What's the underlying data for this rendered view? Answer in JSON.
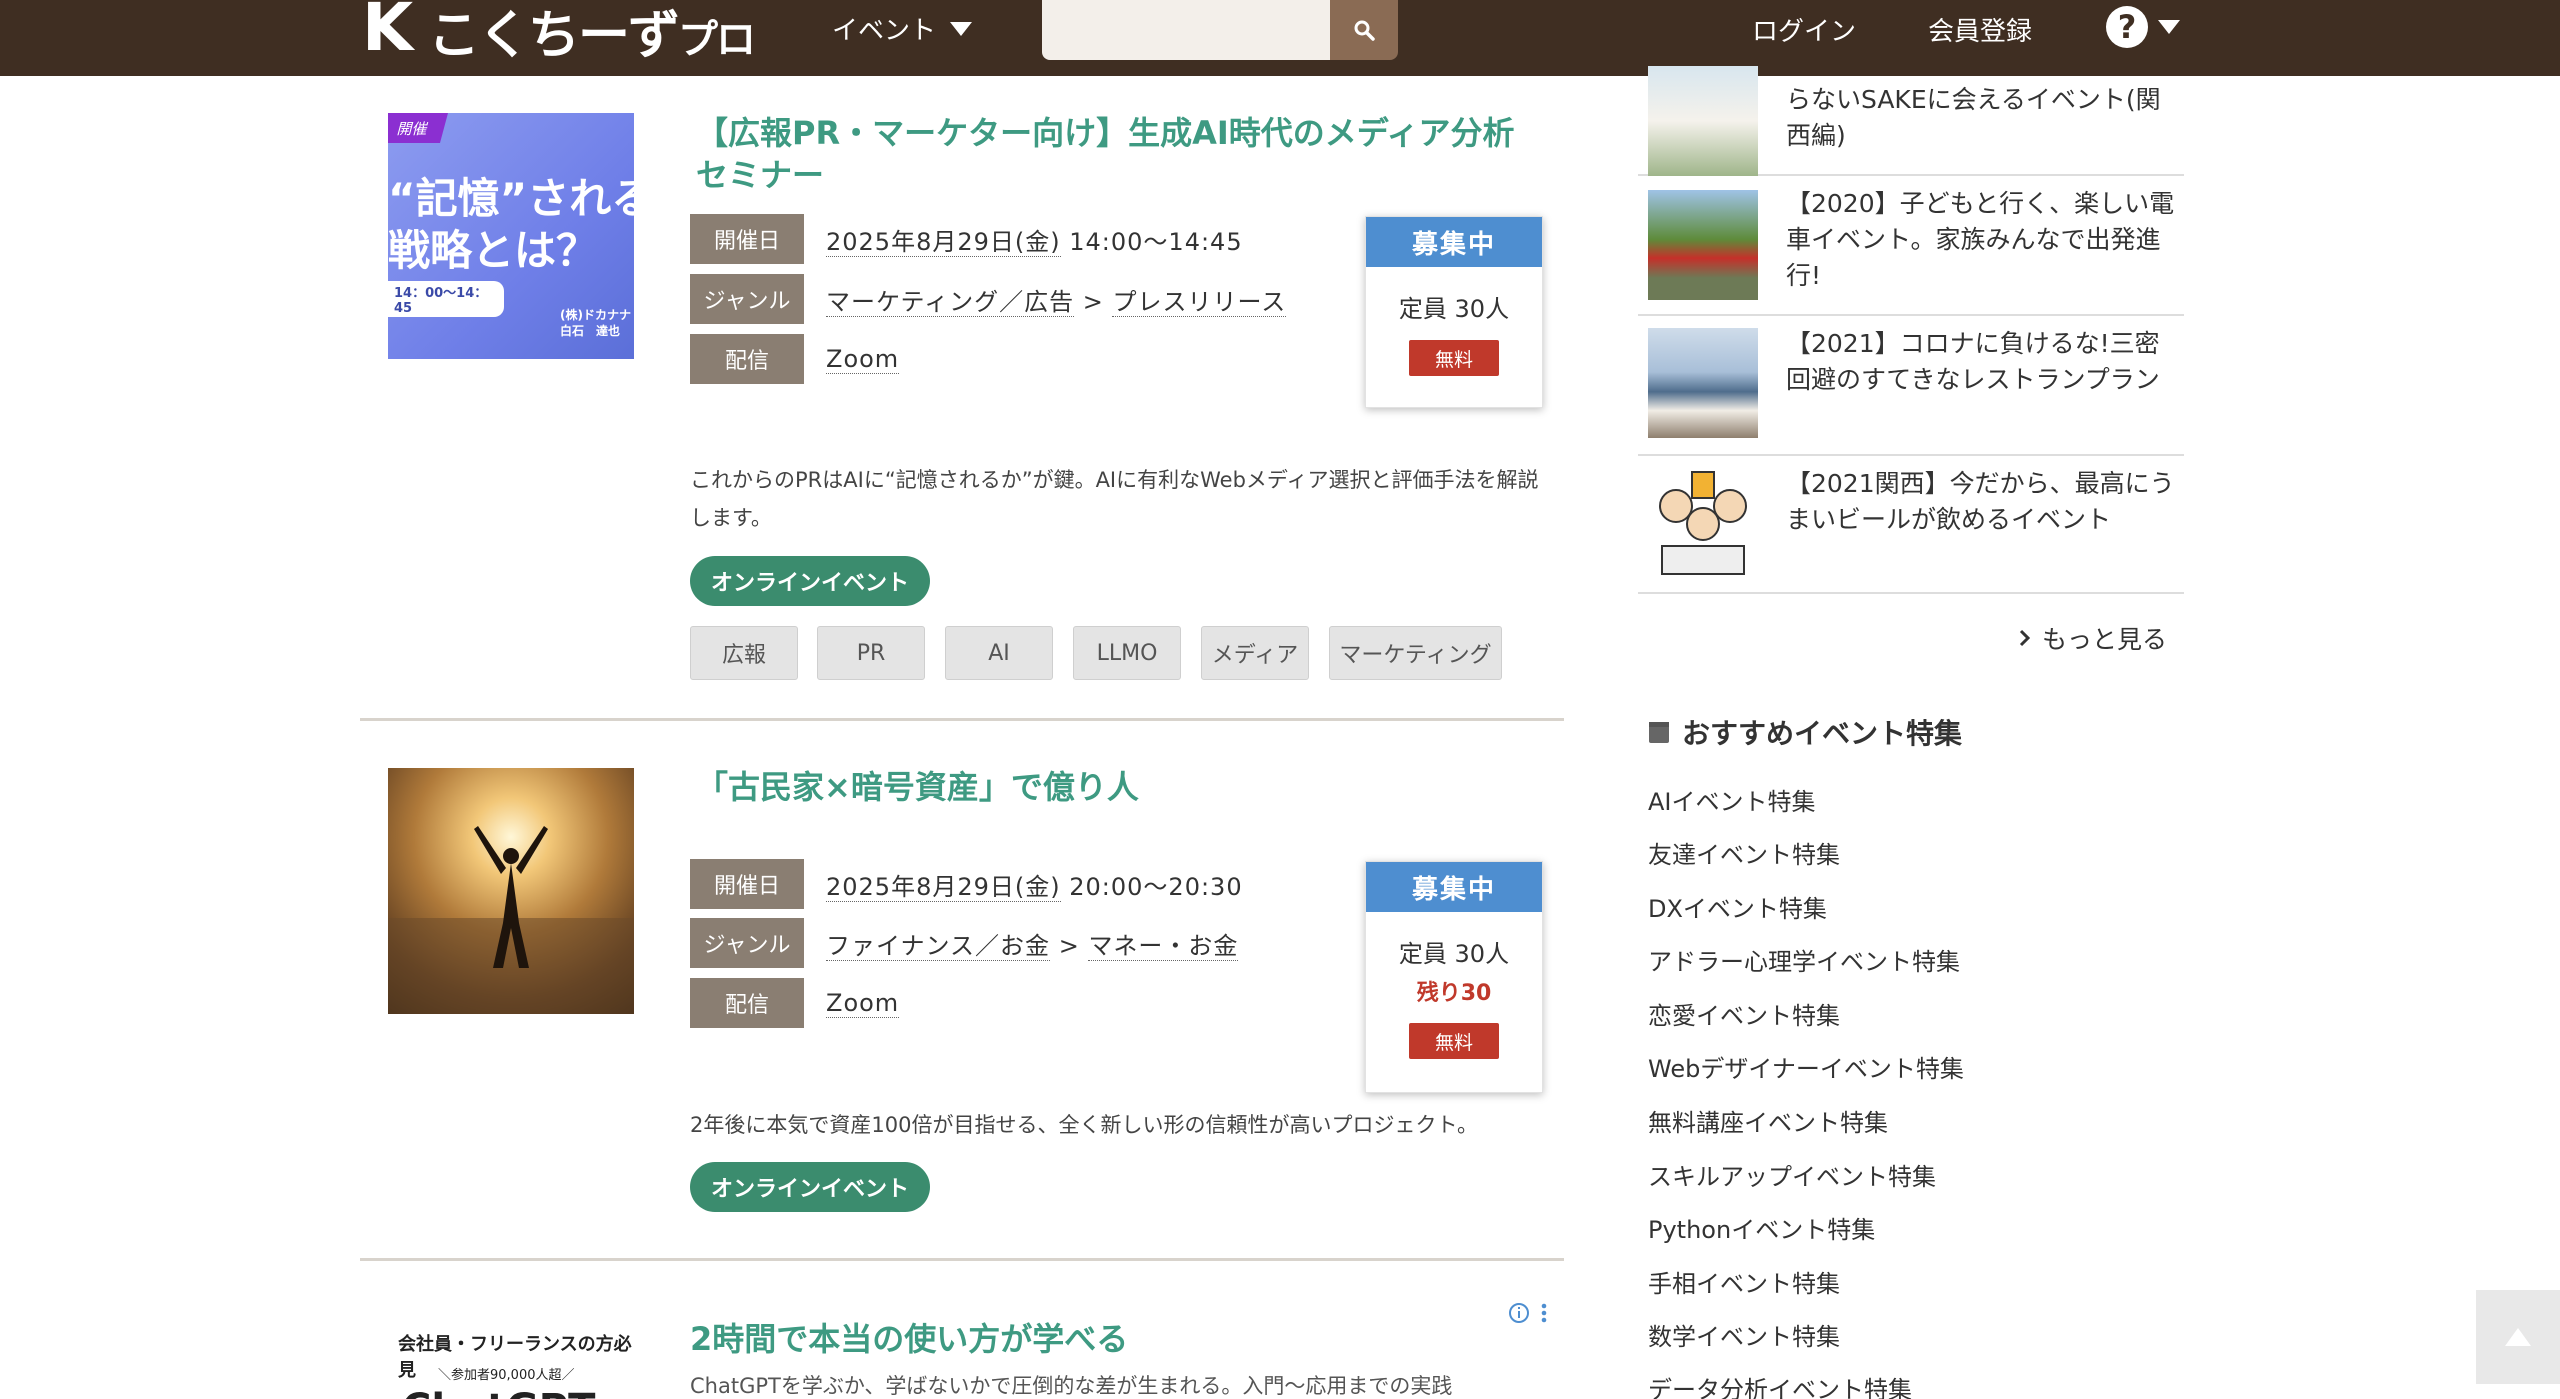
{
  "header": {
    "logo_main": "こくちーず",
    "logo_sub": "プロ",
    "nav_event": "イベント",
    "search_placeholder": "",
    "login": "ログイン",
    "register": "会員登録",
    "help": "?"
  },
  "events": [
    {
      "title": "【広報PR・マーケター向け】生成AI時代のメディア分析セミナー",
      "thumb_badge": "開催",
      "thumb_heading": "“記憶”される\n戦略とは？",
      "thumb_time": "14：00〜14：45",
      "thumb_who": "(株)ドカナナ\n白石　達也",
      "date_label": "開催日",
      "date_value": "2025年8月29日(金)",
      "time_value": "14:00〜14:45",
      "genre_label": "ジャンル",
      "genre_main": "マーケティング／広告",
      "genre_sep": ">",
      "genre_sub": "プレスリリース",
      "stream_label": "配信",
      "stream_value": "Zoom",
      "status": "募集中",
      "capacity": "定員 30人",
      "remaining": "",
      "price": "無料",
      "description": "これからのPRはAIに“記憶されるか”が鍵。AIに有利なWebメディア選択と評価手法を解説します。",
      "category": "オンラインイベント",
      "tags": [
        "広報",
        "PR",
        "AI",
        "LLMO",
        "メディア",
        "マーケティング"
      ]
    },
    {
      "title": "「古民家×暗号資産」で億り人",
      "date_label": "開催日",
      "date_value": "2025年8月29日(金)",
      "time_value": "20:00〜20:30",
      "genre_label": "ジャンル",
      "genre_main": "ファイナンス／お金",
      "genre_sep": ">",
      "genre_sub": "マネー・お金",
      "stream_label": "配信",
      "stream_value": "Zoom",
      "status": "募集中",
      "capacity": "定員 30人",
      "remaining": "残り30",
      "price": "無料",
      "description": "2年後に本気で資産100倍が目指せる、全く新しい形の信頼性が高いプロジェクト。",
      "category": "オンラインイベント"
    }
  ],
  "ad": {
    "thumb_line1": "会社員・フリーランスの方必見",
    "thumb_line2": "＼参加者90,000人超／",
    "thumb_line3": "ChatGPT",
    "title": "2時間で本当の使い方が学べる",
    "description": "ChatGPTを学ぶか、学ばないかで圧倒的な差が生まれる。入門〜応用までの実践"
  },
  "sidebar": {
    "related": [
      {
        "text": "らないSAKEに会えるイベント(関西編)"
      },
      {
        "text": "【2020】子どもと行く、楽しい電車イベント。家族みんなで出発進行!"
      },
      {
        "text": "【2021】コロナに負けるな!三密回避のすてきなレストランプラン"
      },
      {
        "text": "【2021関西】今だから、最高にうまいビールが飲めるイベント"
      }
    ],
    "more": "もっと見る",
    "features_title": "おすすめイベント特集",
    "features": [
      "AIイベント特集",
      "友達イベント特集",
      "DXイベント特集",
      "アドラー心理学イベント特集",
      "恋愛イベント特集",
      "Webデザイナーイベント特集",
      "無料講座イベント特集",
      "スキルアップイベント特集",
      "Pythonイベント特集",
      "手相イベント特集",
      "数学イベント特集",
      "データ分析イベント特集"
    ]
  },
  "colors": {
    "header_bg": "#3f2e22",
    "accent_green": "#3e9a82",
    "status_blue": "#4e8ed0",
    "free_red": "#c0392b",
    "online_pill": "#3b8c6e"
  }
}
